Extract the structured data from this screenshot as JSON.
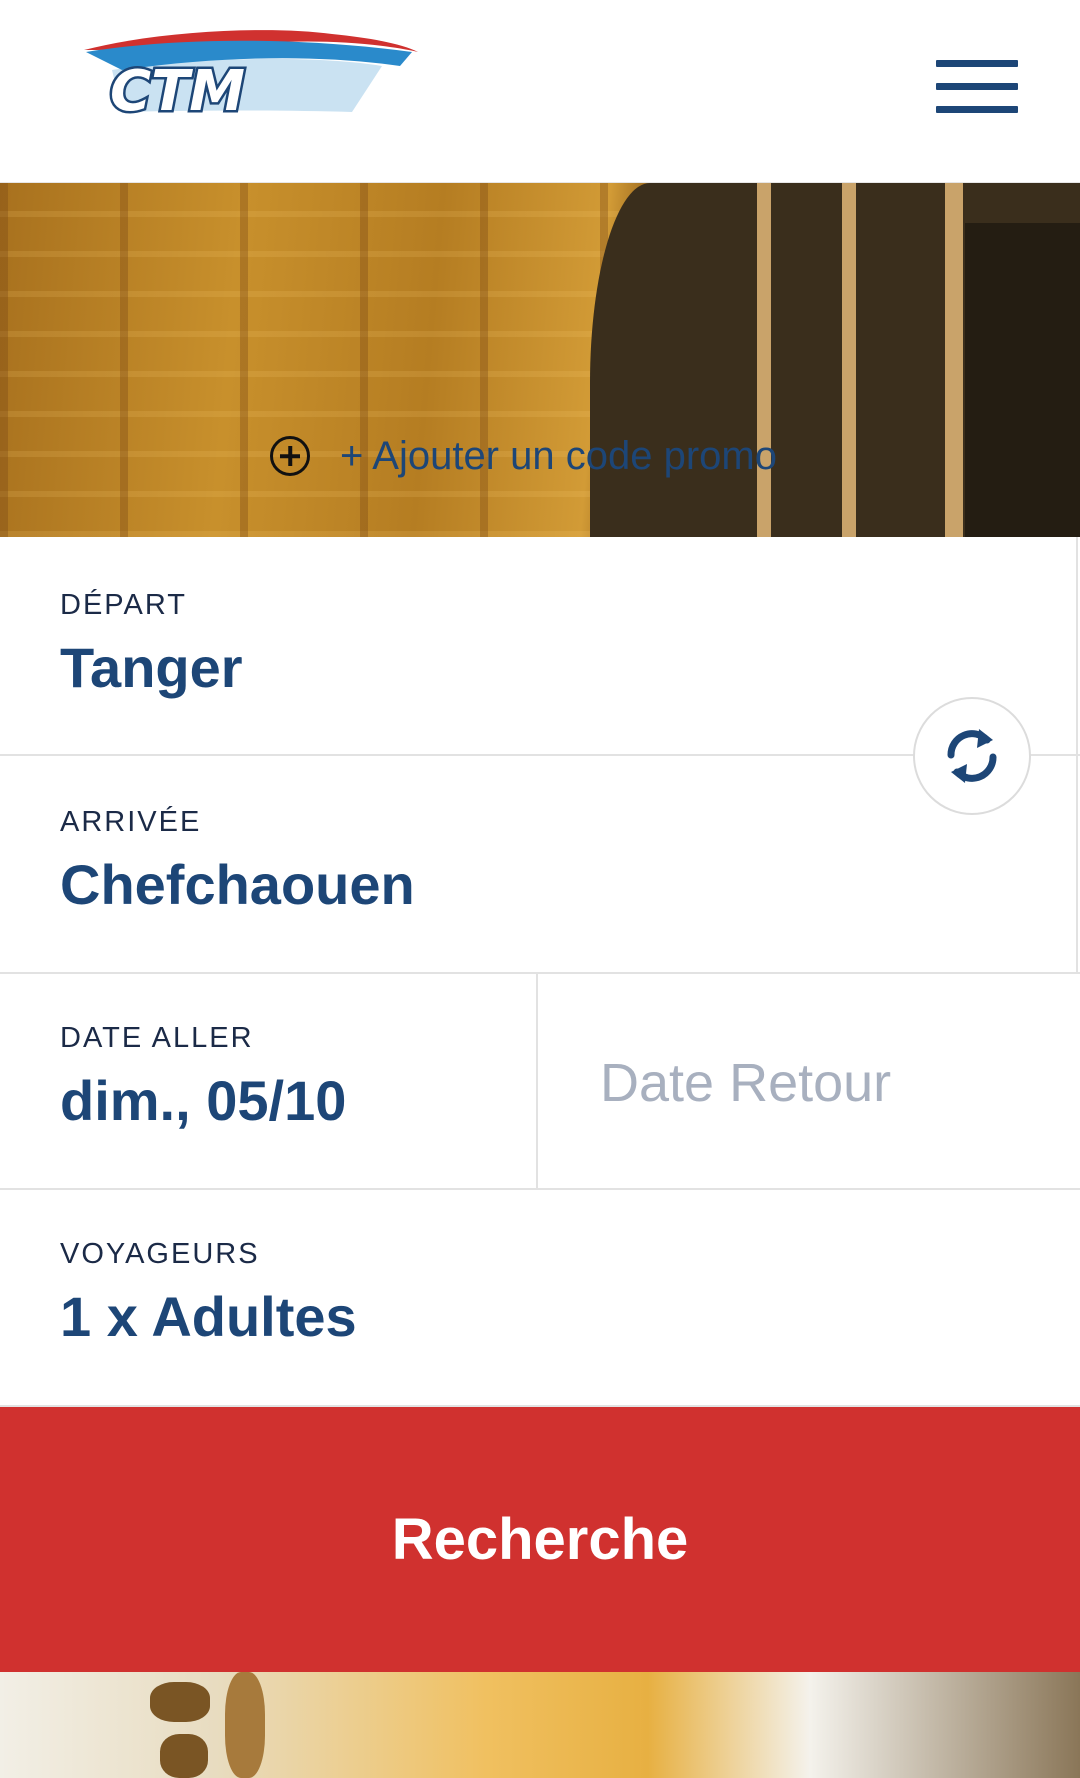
{
  "header": {
    "logo_text": "CTM",
    "menu_icon": "hamburger-menu-icon"
  },
  "hero": {
    "promo_icon": "plus-circle-icon",
    "promo_text": "+ Ajouter un code promo"
  },
  "form": {
    "departure": {
      "label": "DÉPART",
      "value": "Tanger"
    },
    "arrival": {
      "label": "ARRIVÉE",
      "value": "Chefchaouen"
    },
    "swap_icon": "swap-arrows-icon",
    "date_out": {
      "label": "DATE ALLER",
      "value": "dim., 05/10"
    },
    "date_return": {
      "placeholder": "Date Retour"
    },
    "travellers": {
      "label": "VOYAGEURS",
      "value": "1 x Adultes"
    }
  },
  "search_button": {
    "label": "Recherche"
  },
  "colors": {
    "brand_blue": "#1d4677",
    "accent_red": "#d0312f",
    "placeholder_grey": "#a8b0bf",
    "label_dark": "#1b2a47"
  }
}
